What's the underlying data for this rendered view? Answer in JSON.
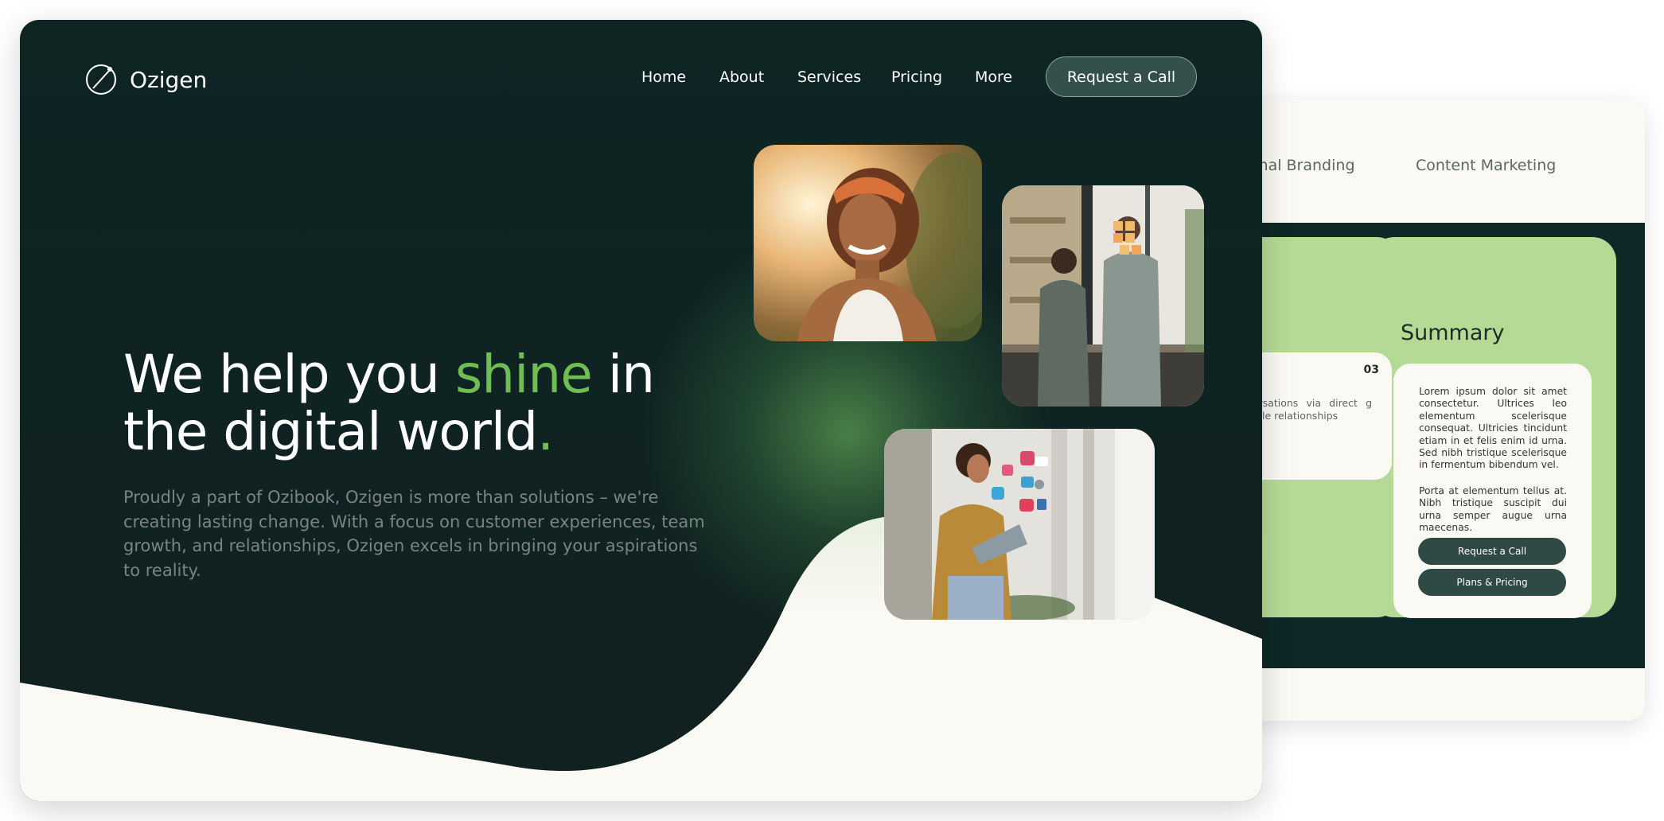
{
  "brand": {
    "name": "Ozigen",
    "accent_color": "#6fbd55",
    "dark_color": "#0e2524"
  },
  "nav": {
    "items": [
      "Home",
      "About",
      "Services",
      "Pricing",
      "More"
    ],
    "cta_label": "Request a Call"
  },
  "hero": {
    "headline_part1": "We help you ",
    "headline_accent": "shine",
    "headline_part2": " in the digital world",
    "headline_dot": ".",
    "subtext": "Proudly a part of Ozibook, Ozigen is more than solutions – we're creating lasting change. With a focus on customer experiences, team growth, and relationships, Ozigen excels in bringing your aspirations to reality."
  },
  "photos": [
    {
      "icon": "smiling-woman-photo"
    },
    {
      "icon": "team-sticky-notes-photo"
    },
    {
      "icon": "woman-tablet-social-photo"
    }
  ],
  "back_card": {
    "tabs": [
      "sonal Branding",
      "Content Marketing"
    ],
    "card_number": "03",
    "card_text": "conversations via direct g voluable relationships",
    "summary_title": "Summary",
    "summary_p1": "Lorem ipsum dolor sit amet consectetur. Ultrices leo elementum scelerisque consequat. Ultricies tincidunt etiam in et felis enim id urna. Sed nibh tristique scelerisque in fermentum bibendum vel.",
    "summary_p2": "Porta at elementum tellus at. Nibh tristique suscipit dui urna semper augue urna maecenas.",
    "summary_btn1": "Request a Call",
    "summary_btn2": "Plans & Pricing"
  }
}
